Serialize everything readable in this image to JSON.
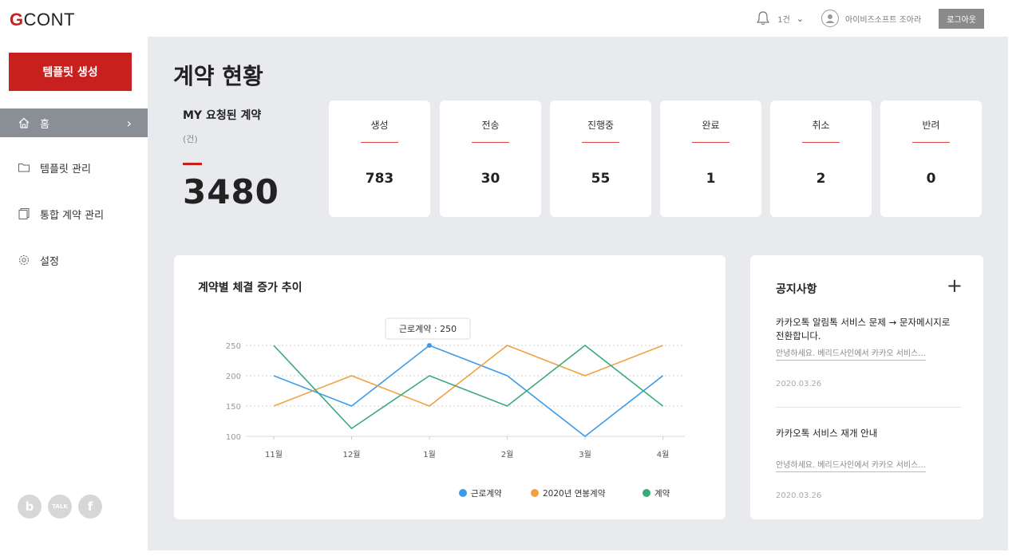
{
  "header": {
    "logo_g": "G",
    "logo_rest": "CONT",
    "notif_count": "1건",
    "user_name": "아이비즈소프트 조아라",
    "logout_label": "로그아웃"
  },
  "sidebar": {
    "create_label": "템플릿 생성",
    "items": [
      {
        "label": "홈",
        "icon": "home-icon"
      },
      {
        "label": "템플릿 관리",
        "icon": "folder-icon"
      },
      {
        "label": "통합 계약 관리",
        "icon": "documents-icon"
      },
      {
        "label": "설정",
        "icon": "gear-icon"
      }
    ],
    "social": [
      "b",
      "TALK",
      "f"
    ]
  },
  "main": {
    "page_title": "계약 현황",
    "my_label": "MY 요청된 계약",
    "my_unit": "(건)",
    "my_count": "3480",
    "stats": [
      {
        "label": "생성",
        "value": "783"
      },
      {
        "label": "전송",
        "value": "30"
      },
      {
        "label": "진행중",
        "value": "55"
      },
      {
        "label": "완료",
        "value": "1"
      },
      {
        "label": "취소",
        "value": "2"
      },
      {
        "label": "반려",
        "value": "0"
      }
    ]
  },
  "chart_data": {
    "type": "line",
    "title": "계약별 체결 증가 추이",
    "categories": [
      "11월",
      "12월",
      "1월",
      "2월",
      "3월",
      "4월"
    ],
    "yticks": [
      100,
      150,
      200,
      250
    ],
    "ylim": [
      100,
      250
    ],
    "grid": true,
    "legend_position": "bottom-right",
    "series": [
      {
        "name": "근로계약",
        "color": "#3a9bea",
        "values": [
          200,
          150,
          250,
          200,
          100,
          200
        ]
      },
      {
        "name": "2020년 연봉계약",
        "color": "#f0a040",
        "values": [
          150,
          200,
          150,
          250,
          200,
          250
        ]
      },
      {
        "name": "계약",
        "color": "#3aaa78",
        "values": [
          250,
          113,
          200,
          150,
          250,
          150
        ]
      }
    ],
    "tooltip": {
      "text": "근로계약 : 250",
      "series": 0,
      "index": 2
    }
  },
  "notices": {
    "title": "공지사항",
    "plus": "+",
    "items": [
      {
        "headline": "카카오톡 알림톡 서비스 문제 → 문자메시지로 전환합니다.",
        "body": "안녕하세요. 베리드사인에서 카카오 서비스...",
        "date": "2020.03.26"
      },
      {
        "headline": "카카오톡 서비스 재개 안내",
        "body": "안녕하세요. 베리드사인에서 카카오 서비스...",
        "date": "2020.03.26"
      }
    ]
  }
}
